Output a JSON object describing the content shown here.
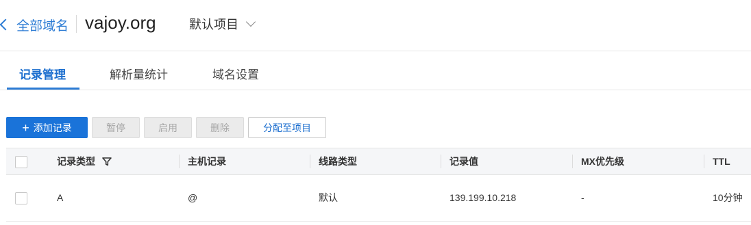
{
  "header": {
    "back_label": "全部域名",
    "domain": "vajoy.org",
    "project_select": "默认项目"
  },
  "tabs": [
    {
      "label": "记录管理",
      "active": true
    },
    {
      "label": "解析量统计",
      "active": false
    },
    {
      "label": "域名设置",
      "active": false
    }
  ],
  "toolbar": {
    "add_record": "添加记录",
    "pause": "暂停",
    "enable": "启用",
    "delete": "删除",
    "assign_project": "分配至项目"
  },
  "table": {
    "columns": [
      "记录类型",
      "主机记录",
      "线路类型",
      "记录值",
      "MX优先级",
      "TTL"
    ],
    "rows": [
      {
        "type": "A",
        "host": "@",
        "line": "默认",
        "value": "139.199.10.218",
        "mx": "-",
        "ttl": "10分钟"
      }
    ]
  },
  "colors": {
    "accent": "#1a73d9",
    "link": "#2b7bd4",
    "header_bg": "#f5f6f8",
    "disabled_bg": "#ebebeb"
  },
  "icons": [
    "chevron-left-icon",
    "chevron-down-icon",
    "plus-icon",
    "filter-icon"
  ]
}
